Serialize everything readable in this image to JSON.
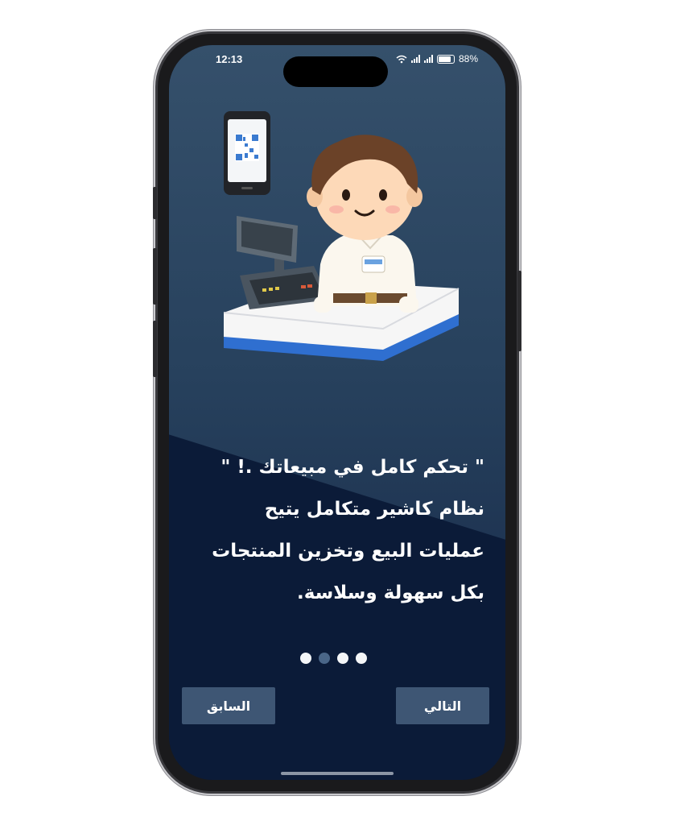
{
  "status_bar": {
    "time": "12:13",
    "battery": "88%",
    "icons": [
      "wifi-icon",
      "signal-icon",
      "battery-icon"
    ]
  },
  "onboarding": {
    "headline_lines": [
      "\" تحكم كامل في مبيعاتك .! \"",
      "نظام كاشير متكامل يتيح",
      "عمليات البيع وتخزين المنتجات",
      "بكل سهولة وسلاسة."
    ],
    "pager": {
      "total": 4,
      "active_index": 1
    },
    "prev_label": "السابق",
    "next_label": "التالي"
  },
  "colors": {
    "screen_top": "#35506b",
    "screen_bottom": "#0b1b38",
    "button_bg": "#3e5674",
    "dot_active": "#4a6688",
    "dot_inactive": "#f4f6f8"
  }
}
